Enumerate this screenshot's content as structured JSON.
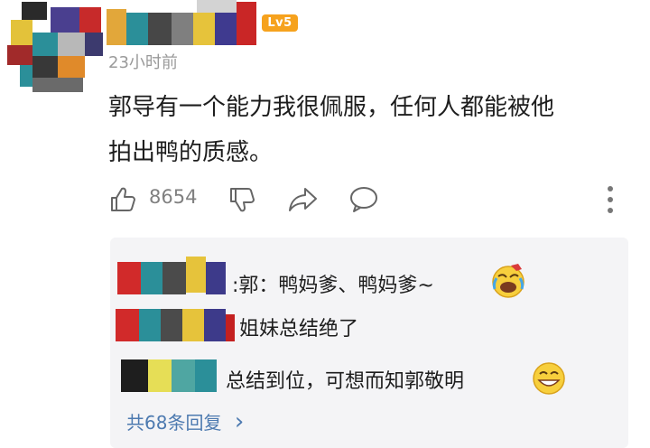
{
  "comment": {
    "level_badge": "Lv5",
    "time": "23小时前",
    "text_line1": "郭导有一个能力我很佩服，任何人都能被他",
    "text_line2": "拍出鸭的质感。",
    "like_count": "8654"
  },
  "replies": {
    "items": [
      {
        "text": ":郭：鸭妈爹、鸭妈爹~",
        "emoji": "laughing-crying-emoji"
      },
      {
        "text": "姐妹总结绝了"
      },
      {
        "text": "总结到位，可想而知郭敬明",
        "emoji": "grinning-emoji"
      }
    ],
    "more_label": "共68条回复",
    "more_arrow": "›"
  },
  "icons": [
    "like-icon",
    "dislike-icon",
    "share-icon",
    "comment-icon",
    "more-options-icon"
  ],
  "colors": {
    "badge": "#f6a21d",
    "link": "#4d7ab0",
    "reply_bg": "#f4f4f6"
  }
}
